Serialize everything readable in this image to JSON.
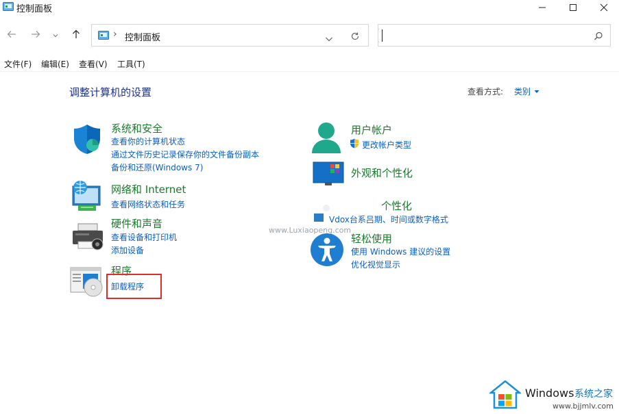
{
  "window": {
    "title": "控制面板",
    "controls": {
      "minimize_icon": "minimize-icon",
      "maximize_icon": "maximize-icon",
      "close_icon": "close-icon"
    }
  },
  "navigation": {
    "back_icon": "arrow-left-icon",
    "forward_icon": "arrow-right-icon",
    "history_icon": "chevron-down-icon",
    "up_icon": "arrow-up-icon",
    "address": {
      "crumb_separator": "›",
      "location": "控制面板"
    },
    "search": {
      "value": ""
    }
  },
  "menu": [
    "文件(F)",
    "编辑(E)",
    "查看(V)",
    "工具(T)"
  ],
  "main": {
    "heading": "调整计算机的设置",
    "view_by": {
      "label": "查看方式:",
      "value": "类别"
    },
    "categories": [
      {
        "title": "系统和安全",
        "icon": "shield-icon",
        "links": [
          "查看你的计算机状态",
          "通过文件历史记录保存你的文件备份副本",
          "备份和还原(Windows 7)"
        ]
      },
      {
        "title": "网络和 Internet",
        "icon": "network-globe-icon",
        "links": [
          "查看网络状态和任务"
        ]
      },
      {
        "title": "硬件和声音",
        "icon": "printer-icon",
        "links": [
          "查看设备和打印机",
          "添加设备"
        ]
      },
      {
        "title": "程序",
        "icon": "programs-icon",
        "links": [
          "卸载程序"
        ]
      },
      {
        "title": "用户帐户",
        "icon": "user-icon",
        "links": [
          "更改帐户类型"
        ]
      },
      {
        "title": "外观和个性化",
        "icon": "appearance-icon",
        "links": []
      },
      {
        "title": "个性化",
        "icon": "clock-region-icon",
        "links": [
          "Vdox台系吕期、时间或数字格式"
        ]
      },
      {
        "title": "轻松使用",
        "icon": "accessibility-icon",
        "links": [
          "使用 Windows 建议的设置",
          "优化视觉显示"
        ]
      }
    ]
  },
  "overlay": {
    "watermark": "www.Luxiaopeng.com",
    "brand": {
      "name": "Windows",
      "name_cn": "系统之家",
      "url": "www.bjjmlv.com"
    }
  },
  "colors": {
    "link": "#0b5fc4",
    "category": "#1a7a2c",
    "heading": "#1e3287",
    "highlight": "#e02b2b"
  }
}
